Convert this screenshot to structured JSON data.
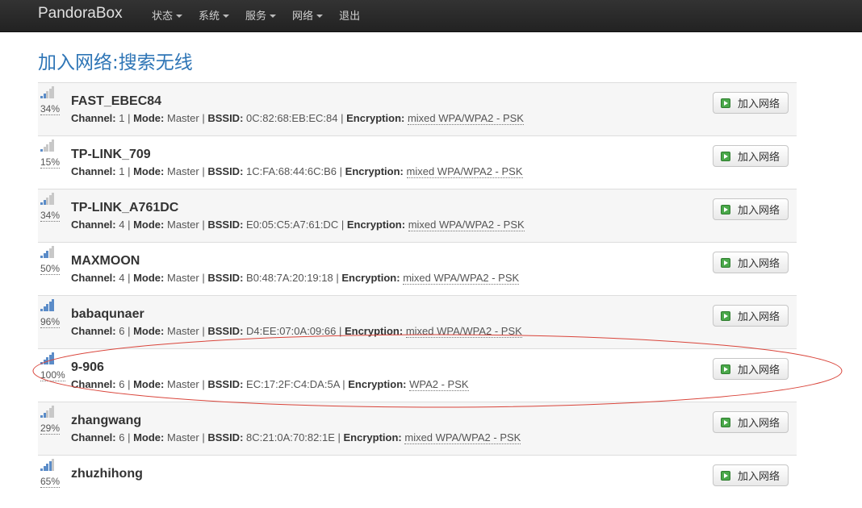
{
  "navbar": {
    "brand": "PandoraBox",
    "menu": [
      {
        "label": "状态",
        "dropdown": true
      },
      {
        "label": "系统",
        "dropdown": true
      },
      {
        "label": "服务",
        "dropdown": true
      },
      {
        "label": "网络",
        "dropdown": true
      },
      {
        "label": "退出",
        "dropdown": false
      }
    ]
  },
  "page_title": "加入网络:搜索无线",
  "labels": {
    "channel": "Channel:",
    "mode": "Mode:",
    "bssid": "BSSID:",
    "encryption": "Encryption:",
    "separator": " | "
  },
  "join_button_label": "加入网络",
  "networks": [
    {
      "ssid": "FAST_EBEC84",
      "signal": "34%",
      "level": 2,
      "channel": "1",
      "mode": "Master",
      "bssid": "0C:82:68:EB:EC:84",
      "encryption": "mixed WPA/WPA2 - PSK"
    },
    {
      "ssid": "TP-LINK_709",
      "signal": "15%",
      "level": 1,
      "channel": "1",
      "mode": "Master",
      "bssid": "1C:FA:68:44:6C:B6",
      "encryption": "mixed WPA/WPA2 - PSK"
    },
    {
      "ssid": "TP-LINK_A761DC",
      "signal": "34%",
      "level": 2,
      "channel": "4",
      "mode": "Master",
      "bssid": "E0:05:C5:A7:61:DC",
      "encryption": "mixed WPA/WPA2 - PSK"
    },
    {
      "ssid": "MAXMOON",
      "signal": "50%",
      "level": 3,
      "channel": "4",
      "mode": "Master",
      "bssid": "B0:48:7A:20:19:18",
      "encryption": "mixed WPA/WPA2 - PSK"
    },
    {
      "ssid": "babaqunaer",
      "signal": "96%",
      "level": 5,
      "channel": "6",
      "mode": "Master",
      "bssid": "D4:EE:07:0A:09:66",
      "encryption": "mixed WPA/WPA2 - PSK"
    },
    {
      "ssid": "9-906",
      "signal": "100%",
      "level": 5,
      "channel": "6",
      "mode": "Master",
      "bssid": "EC:17:2F:C4:DA:5A",
      "encryption": "WPA2 - PSK",
      "highlighted": true
    },
    {
      "ssid": "zhangwang",
      "signal": "29%",
      "level": 2,
      "channel": "6",
      "mode": "Master",
      "bssid": "8C:21:0A:70:82:1E",
      "encryption": "mixed WPA/WPA2 - PSK"
    },
    {
      "ssid": "zhuzhihong",
      "signal": "65%",
      "level": 4,
      "channel": "",
      "mode": "",
      "bssid": "",
      "encryption": ""
    }
  ],
  "colors": {
    "title": "#2e75b6",
    "signal_on": "#5b8cc8",
    "signal_off": "#c8c8c8",
    "annotation": "#d9443a"
  },
  "icons": {
    "signal": "wifi-signal-icon",
    "join": "play-icon"
  }
}
